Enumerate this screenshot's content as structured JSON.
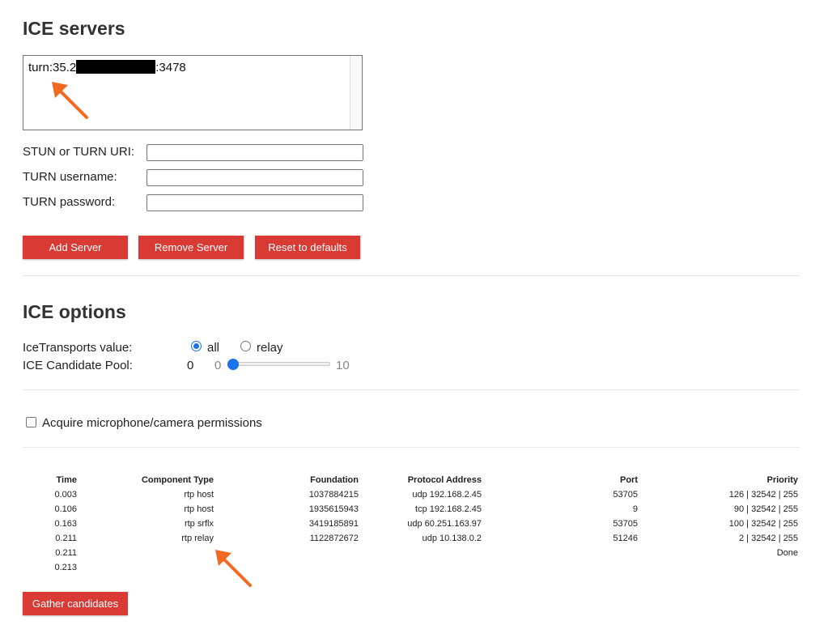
{
  "ice_servers": {
    "title": "ICE servers",
    "server_list": [
      {
        "prefix": "turn:35.2",
        "suffix": ":3478"
      }
    ],
    "fields": {
      "uri_label": "STUN or TURN URI:",
      "uri_value": "",
      "username_label": "TURN username:",
      "username_value": "",
      "password_label": "TURN password:",
      "password_value": ""
    },
    "buttons": {
      "add": "Add Server",
      "remove": "Remove Server",
      "reset": "Reset to defaults"
    }
  },
  "ice_options": {
    "title": "ICE options",
    "transports_label": "IceTransports value:",
    "transport_all": "all",
    "transport_relay": "relay",
    "selected_transport": "all",
    "pool_label": "ICE Candidate Pool:",
    "pool_value": "0",
    "pool_min": "0",
    "pool_max": "10"
  },
  "permissions": {
    "label": "Acquire microphone/camera permissions",
    "checked": false
  },
  "candidates": {
    "headers": {
      "time": "Time",
      "component_type": "Component Type",
      "foundation": "Foundation",
      "protocol_address": "Protocol Address",
      "port": "Port",
      "priority": "Priority"
    },
    "rows": [
      {
        "time": "0.003",
        "component_type": "rtp host",
        "foundation": "1037884215",
        "protocol_address": "udp 192.168.2.45",
        "port": "53705",
        "priority": "126 | 32542 | 255"
      },
      {
        "time": "0.106",
        "component_type": "rtp host",
        "foundation": "1935615943",
        "protocol_address": "tcp 192.168.2.45",
        "port": "9",
        "priority": "90 | 32542 | 255"
      },
      {
        "time": "0.163",
        "component_type": "rtp srflx",
        "foundation": "3419185891",
        "protocol_address": "udp 60.251.163.97",
        "port": "53705",
        "priority": "100 | 32542 | 255"
      },
      {
        "time": "0.211",
        "component_type": "rtp relay",
        "foundation": "1122872672",
        "protocol_address": "udp 10.138.0.2",
        "port": "51246",
        "priority": "2 | 32542 | 255"
      },
      {
        "time": "0.211",
        "component_type": "",
        "foundation": "",
        "protocol_address": "",
        "port": "",
        "priority": "Done"
      },
      {
        "time": "0.213",
        "component_type": "",
        "foundation": "",
        "protocol_address": "",
        "port": "",
        "priority": ""
      }
    ],
    "gather_button": "Gather candidates"
  },
  "colors": {
    "button_red": "#d93a34",
    "accent_blue": "#1a73e8",
    "annotation_arrow": "#f26a21"
  },
  "icons": {
    "annotation": "arrow-icon"
  }
}
